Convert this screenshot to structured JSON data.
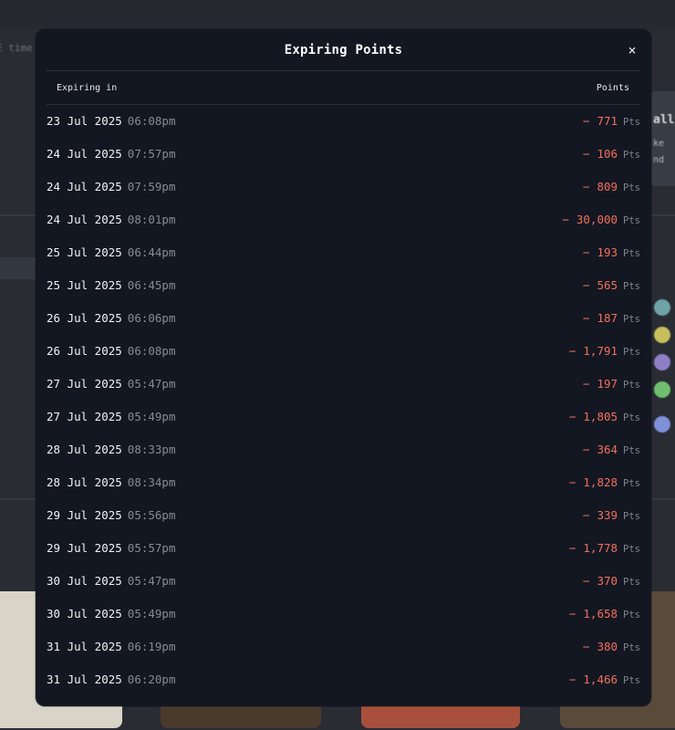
{
  "modal": {
    "title": "Expiring Points",
    "close_icon": "×",
    "columns": {
      "expiring": "Expiring in",
      "points": "Points"
    },
    "rows": [
      {
        "date": "23 Jul 2025",
        "time": "06:08pm",
        "sign": "−",
        "points": "771",
        "unit": "Pts"
      },
      {
        "date": "24 Jul 2025",
        "time": "07:57pm",
        "sign": "−",
        "points": "106",
        "unit": "Pts"
      },
      {
        "date": "24 Jul 2025",
        "time": "07:59pm",
        "sign": "−",
        "points": "809",
        "unit": "Pts"
      },
      {
        "date": "24 Jul 2025",
        "time": "08:01pm",
        "sign": "−",
        "points": "30,000",
        "unit": "Pts"
      },
      {
        "date": "25 Jul 2025",
        "time": "06:44pm",
        "sign": "−",
        "points": "193",
        "unit": "Pts"
      },
      {
        "date": "25 Jul 2025",
        "time": "06:45pm",
        "sign": "−",
        "points": "565",
        "unit": "Pts"
      },
      {
        "date": "26 Jul 2025",
        "time": "06:06pm",
        "sign": "−",
        "points": "187",
        "unit": "Pts"
      },
      {
        "date": "26 Jul 2025",
        "time": "06:08pm",
        "sign": "−",
        "points": "1,791",
        "unit": "Pts"
      },
      {
        "date": "27 Jul 2025",
        "time": "05:47pm",
        "sign": "−",
        "points": "197",
        "unit": "Pts"
      },
      {
        "date": "27 Jul 2025",
        "time": "05:49pm",
        "sign": "−",
        "points": "1,805",
        "unit": "Pts"
      },
      {
        "date": "28 Jul 2025",
        "time": "08:33pm",
        "sign": "−",
        "points": "364",
        "unit": "Pts"
      },
      {
        "date": "28 Jul 2025",
        "time": "08:34pm",
        "sign": "−",
        "points": "1,828",
        "unit": "Pts"
      },
      {
        "date": "29 Jul 2025",
        "time": "05:56pm",
        "sign": "−",
        "points": "339",
        "unit": "Pts"
      },
      {
        "date": "29 Jul 2025",
        "time": "05:57pm",
        "sign": "−",
        "points": "1,778",
        "unit": "Pts"
      },
      {
        "date": "30 Jul 2025",
        "time": "05:47pm",
        "sign": "−",
        "points": "370",
        "unit": "Pts"
      },
      {
        "date": "30 Jul 2025",
        "time": "05:49pm",
        "sign": "−",
        "points": "1,658",
        "unit": "Pts"
      },
      {
        "date": "31 Jul 2025",
        "time": "06:19pm",
        "sign": "−",
        "points": "380",
        "unit": "Pts"
      },
      {
        "date": "31 Jul 2025",
        "time": "06:20pm",
        "sign": "−",
        "points": "1,466",
        "unit": "Pts"
      }
    ]
  },
  "backdrop": {
    "left_fragment": "E time",
    "right_fragments": [
      "ally",
      "ke",
      "nd"
    ]
  },
  "colors": {
    "modal_bg": "#131722",
    "negative_points": "#f0705a",
    "muted_text": "#858b96"
  }
}
